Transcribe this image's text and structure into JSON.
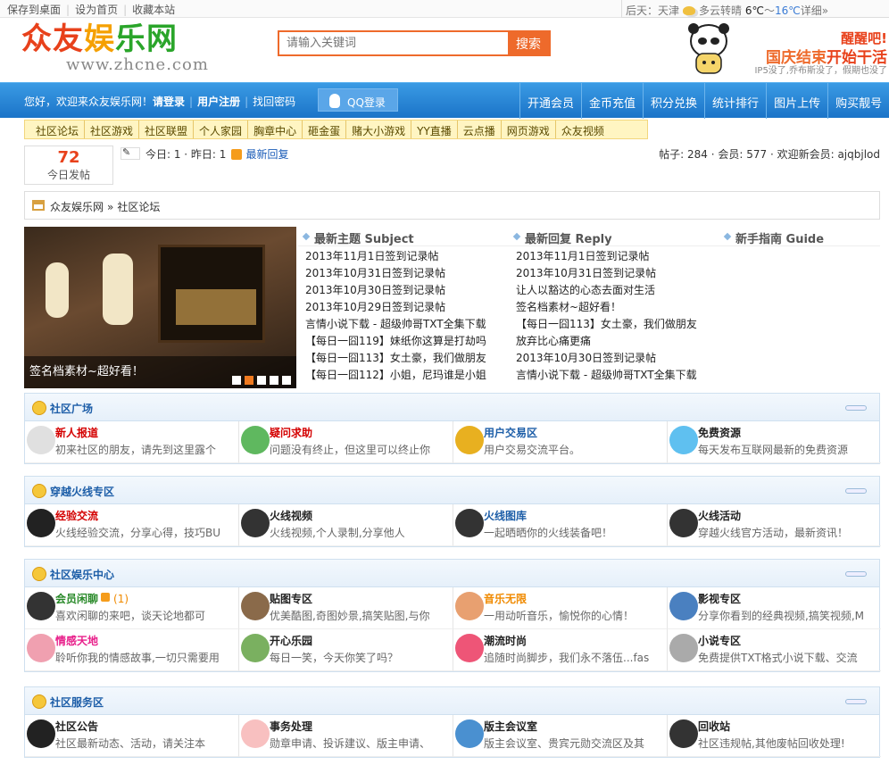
{
  "topbar": {
    "links": [
      "保存到桌面",
      "设为首页",
      "收藏本站"
    ],
    "weather": {
      "day": "后天：",
      "city": "天津",
      "desc": "多云转晴",
      "low": "6℃",
      "sep": "～",
      "high": "16℃",
      "detail": "详细»"
    }
  },
  "header": {
    "logo_a": "众友",
    "logo_b": "娱",
    "logo_c": "乐网",
    "logo_url": "www.zhcne.com",
    "search_placeholder": "请输入关键词",
    "search_button": "搜索",
    "ad_l1": "醒醒吧!",
    "ad_l2a": "国庆结束",
    "ad_l2b": "开始干活",
    "ad_l3": "IP5没了,乔布斯没了，假期也没了"
  },
  "nav": {
    "greeting": "您好，欢迎来众友娱乐网！",
    "login": "请登录",
    "register": "用户注册",
    "recover": "找回密码",
    "qq_login": "QQ登录",
    "right": [
      "开通会员",
      "金币充值",
      "积分兑换",
      "统计排行",
      "图片上传",
      "购买靓号"
    ]
  },
  "subnav": [
    "社区论坛",
    "社区游戏",
    "社区联盟",
    "个人家园",
    "胸章中心",
    "砸金蛋",
    "赌大小游戏",
    "YY直播",
    "云点播",
    "网页游戏",
    "众友视频"
  ],
  "stats": {
    "today_num": "72",
    "today_label": "今日发帖",
    "today_text": "今日: 1 · 昨日: 1",
    "latest_reply": "最新回复",
    "right": "帖子: 284 · 会员: 577 · 欢迎新会员: ajqbjlod"
  },
  "breadcrumb": {
    "home": "众友娱乐网",
    "sep": "»",
    "current": "社区论坛"
  },
  "slideshow": {
    "caption": "签名档素材~超好看！",
    "slide_count": 5,
    "active_index": 1
  },
  "latest": {
    "subject_title": "最新主题 Subject",
    "subjects": [
      "2013年11月1日签到记录帖",
      "2013年10月31日签到记录帖",
      "2013年10月30日签到记录帖",
      "2013年10月29日签到记录帖",
      "言情小说下载 - 超级帅哥TXT全集下载",
      "【每日一囧119】妹纸你这算是打劫吗",
      "【每日一囧113】女土豪，我们做朋友",
      "【每日一囧112】小姐，尼玛谁是小姐"
    ],
    "reply_title": "最新回复 Reply",
    "replies": [
      "2013年11月1日签到记录帖",
      "2013年10月31日签到记录帖",
      "让人以豁达的心态去面对生活",
      "签名档素材~超好看！",
      "【每日一囧113】女土豪，我们做朋友",
      "放弃比心痛更痛",
      "2013年10月30日签到记录帖",
      "言情小说下载 - 超级帅哥TXT全集下载"
    ],
    "guide_title": "新手指南 Guide"
  },
  "sections": [
    {
      "title": "社区广场",
      "forums": [
        {
          "name": "新人报道",
          "desc": "初来社区的朋友，请先到这里露个",
          "color": "red"
        },
        {
          "name": "疑问求助",
          "desc": "问题没有终止，但这里可以终止你",
          "color": "red"
        },
        {
          "name": "用户交易区",
          "desc": "用户交易交流平台。",
          "color": "blue"
        },
        {
          "name": "免费资源",
          "desc": "每天发布互联网最新的免费资源",
          "color": "dark"
        }
      ]
    },
    {
      "title": "穿越火线专区",
      "forums": [
        {
          "name": "经验交流",
          "desc": "火线经验交流，分享心得，技巧BU",
          "color": "red"
        },
        {
          "name": "火线视频",
          "desc": "火线视频,个人录制,分享他人",
          "color": "dark"
        },
        {
          "name": "火线图库",
          "desc": "一起晒晒你的火线装备吧！",
          "color": "blue"
        },
        {
          "name": "火线活动",
          "desc": "穿越火线官方活动，最新资讯！",
          "color": "dark"
        }
      ]
    },
    {
      "title": "社区娱乐中心",
      "forums": [
        {
          "name": "会员闲聊",
          "desc": "喜欢闲聊的来吧，谈天论地都可",
          "color": "green",
          "badge": true,
          "count": "(1)"
        },
        {
          "name": "贴图专区",
          "desc": "优美酷图,奇图妙景,搞笑贴图,与你",
          "color": "dark"
        },
        {
          "name": "音乐无限",
          "desc": "一用动听音乐，愉悦你的心情！",
          "color": "orange"
        },
        {
          "name": "影视专区",
          "desc": "分享你看到的经典视频,搞笑视频,M",
          "color": "dark"
        },
        {
          "name": "情感天地",
          "desc": "聆听你我的情感故事,一切只需要用",
          "color": "pink"
        },
        {
          "name": "开心乐园",
          "desc": "每日一笑，今天你笑了吗？",
          "color": "dark"
        },
        {
          "name": "潮流时尚",
          "desc": "追随时尚脚步，我们永不落伍...fas",
          "color": "dark"
        },
        {
          "name": "小说专区",
          "desc": "免费提供TXT格式小说下载、交流",
          "color": "dark"
        }
      ]
    },
    {
      "title": "社区服务区",
      "forums": [
        {
          "name": "社区公告",
          "desc": "社区最新动态、活动，请关注本",
          "color": "dark"
        },
        {
          "name": "事务处理",
          "desc": "勋章申请、投诉建议、版主申请、",
          "color": "dark"
        },
        {
          "name": "版主会议室",
          "desc": "版主会议室、贵宾元勋交流区及其",
          "color": "dark"
        },
        {
          "name": "回收站",
          "desc": "社区违规帖,其他废帖回收处理!",
          "color": "dark"
        }
      ]
    }
  ],
  "colors": {
    "accent": "#ee6a2b",
    "nav_blue": "#1b74c8",
    "link_blue": "#1d5ea8",
    "red": "#d40000"
  }
}
